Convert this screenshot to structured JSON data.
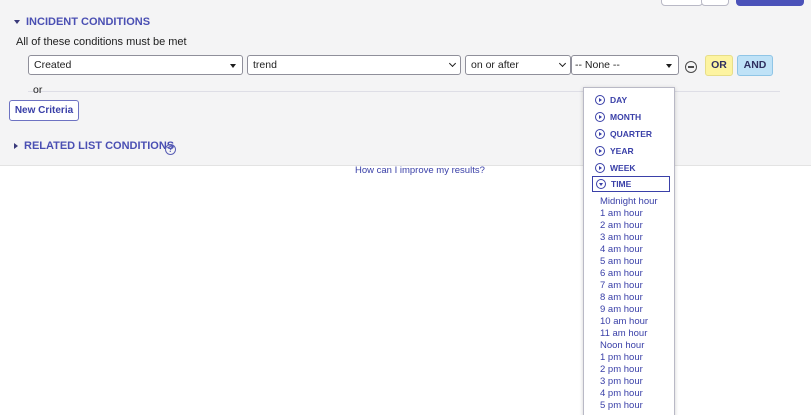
{
  "incident_section": {
    "title": "INCIDENT CONDITIONS",
    "conditions_text": "All of these conditions must be met"
  },
  "condition_row": {
    "field_value": "Created",
    "trend_value": "trend",
    "operator_value": "on or after",
    "value_value": "-- None --",
    "or_label": "OR",
    "and_label": "AND"
  },
  "or_separator": "or",
  "new_criteria_label": "New Criteria",
  "related_section": {
    "title": "RELATED LIST CONDITIONS"
  },
  "improve_link": "How can I improve my results?",
  "dropdown": {
    "groups": [
      {
        "label": "DAY",
        "expanded": false
      },
      {
        "label": "MONTH",
        "expanded": false
      },
      {
        "label": "QUARTER",
        "expanded": false
      },
      {
        "label": "YEAR",
        "expanded": false
      },
      {
        "label": "WEEK",
        "expanded": false
      },
      {
        "label": "TIME",
        "expanded": true
      }
    ],
    "time_options": [
      "Midnight hour",
      "1 am hour",
      "2 am hour",
      "3 am hour",
      "4 am hour",
      "5 am hour",
      "6 am hour",
      "7 am hour",
      "8 am hour",
      "9 am hour",
      "10 am hour",
      "11 am hour",
      "Noon hour",
      "1 pm hour",
      "2 pm hour",
      "3 pm hour",
      "4 pm hour",
      "5 pm hour"
    ]
  },
  "colors": {
    "accent": "#3a40a8",
    "or_button": "#fdf4a1",
    "and_button": "#bfe2f7",
    "panel_background": "#f4f4f5"
  }
}
